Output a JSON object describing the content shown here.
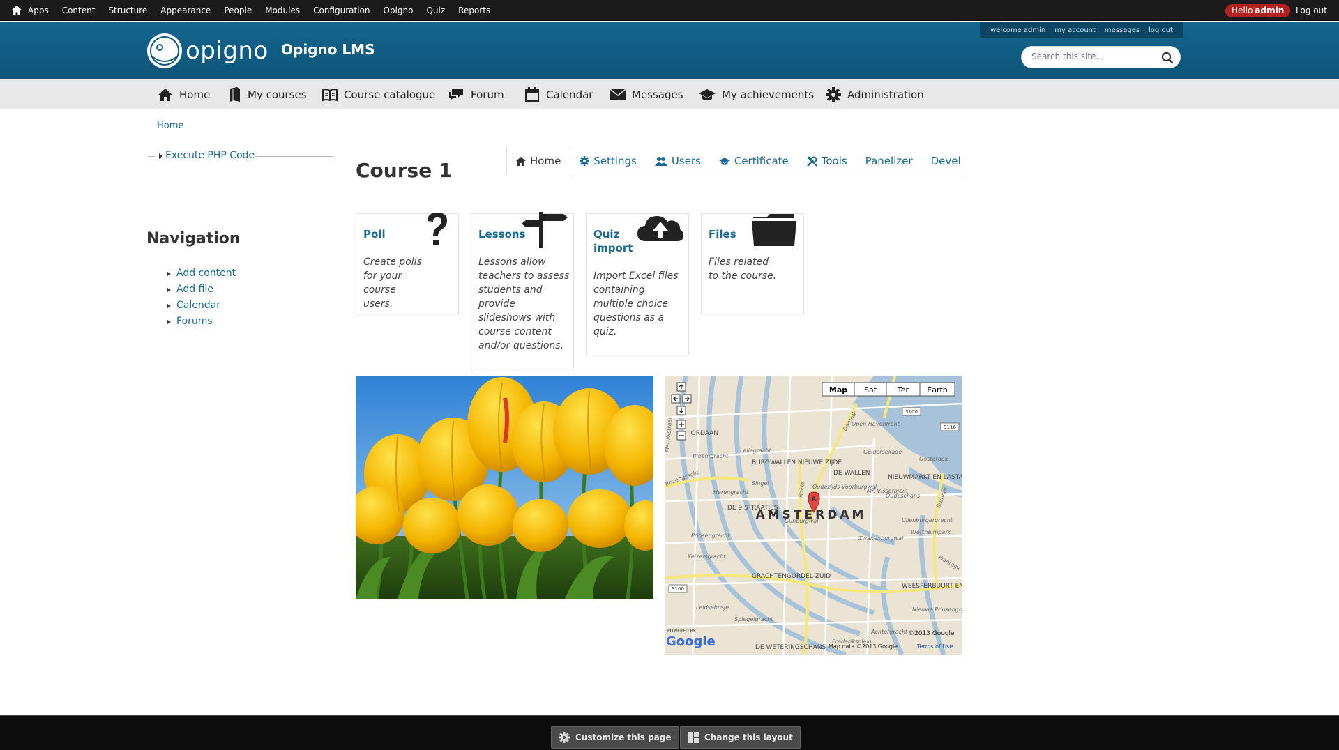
{
  "admin_bar": {
    "menu": [
      "Apps",
      "Content",
      "Structure",
      "Appearance",
      "People",
      "Modules",
      "Configuration",
      "Opigno",
      "Quiz",
      "Reports"
    ],
    "hello_prefix": "Hello",
    "hello_user": "admin",
    "logout": "Log out"
  },
  "header": {
    "logo_text": "opigno",
    "site_name": "Opigno LMS",
    "welcome": "welcome admin",
    "my_account": "my account",
    "messages": "messages",
    "log_out": "log out",
    "search_placeholder": "Search this site..."
  },
  "main_nav": [
    "Home",
    "My courses",
    "Course catalogue",
    "Forum",
    "Calendar",
    "Messages",
    "My achievements",
    "Administration"
  ],
  "breadcrumb": "Home",
  "sidebar": {
    "php_link": "Execute PHP Code",
    "nav_title": "Navigation",
    "nav_items": [
      "Add content",
      "Add file",
      "Calendar",
      "Forums"
    ]
  },
  "content": {
    "title": "Course 1",
    "tabs": [
      "Home",
      "Settings",
      "Users",
      "Certificate",
      "Tools",
      "Panelizer",
      "Devel"
    ],
    "cards": [
      {
        "title": "Poll",
        "desc": "Create polls for your course users.",
        "icon": "question-mark-icon"
      },
      {
        "title": "Lessons",
        "desc": "Lessons allow teachers to assess students and provide slideshows with course content and/or questions.",
        "icon": "signpost-icon"
      },
      {
        "title": "Quiz import",
        "desc": "Import Excel files containing multiple choice questions as a quiz.",
        "icon": "cloud-upload-icon"
      },
      {
        "title": "Files",
        "desc": "Files related to the course.",
        "icon": "folder-icon"
      }
    ]
  },
  "map": {
    "types": [
      "Map",
      "Sat",
      "Ter",
      "Earth"
    ],
    "city": "AMSTERDAM",
    "districts": [
      "JORDAAN",
      "BURGWALLEN NIEUWE ZIJDE",
      "DE WALLEN",
      "NIEUWMARKT EN LASTAGE",
      "DE 9 STRAATJES",
      "GRACHTENGORDEL-ZUID",
      "WEESPERBUURT EN PLANTAGE",
      "DE WETERINGSCHANS"
    ],
    "streets": [
      "Damrak",
      "Rokin",
      "Singel",
      "Herengracht",
      "Prinsengracht",
      "Keizersgracht",
      "Bloemgracht",
      "Leliegracht",
      "Oudezijds Voorburgwal",
      "Oudeschans",
      "Uilenburgergracht",
      "Wertheimpark",
      "Zwanenburgwal",
      "Plantage",
      "Leidsebosje",
      "Spiegelgracht",
      "Achtergracht",
      "Frederiksplein",
      "Nieuwe Prinsengracht",
      "Geldersekade",
      "Oosterdok",
      "Open Havenfront",
      "Gunburgwal",
      "Marnixstraat",
      "Rozengracht",
      "Mr. Visserplein",
      "IJtunnel"
    ],
    "road_labels": [
      "S100",
      "S116",
      "S100"
    ],
    "marker": "A",
    "powered_by": "POWERED BY",
    "google": "Google",
    "copyright": "©2013 Google",
    "attribution": "Map data ©2013 Google",
    "terms": "Terms of Use"
  },
  "bottom_bar": {
    "customize": "Customize this page",
    "change_layout": "Change this layout"
  },
  "colors": {
    "header_bg": "#0f5a7f",
    "link": "#1a6a93",
    "hello_badge": "#b42020",
    "admin_bar": "#1b1b1b"
  }
}
